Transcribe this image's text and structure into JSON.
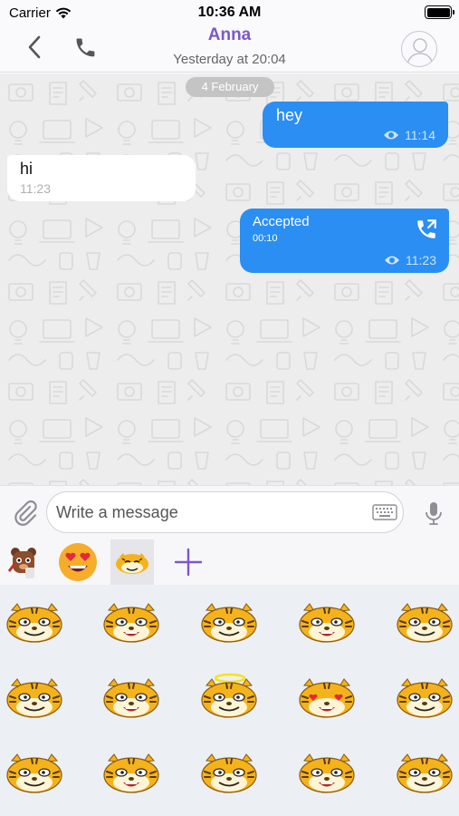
{
  "status_bar": {
    "carrier": "Carrier",
    "time": "10:36 AM"
  },
  "header": {
    "contact_name": "Anna",
    "last_seen": "Yesterday at 20:04"
  },
  "chat": {
    "date_separator": "4 February",
    "messages": [
      {
        "direction": "outgoing",
        "text": "hey",
        "time": "11:14",
        "status": "seen-eye-icon"
      },
      {
        "direction": "incoming",
        "text": "hi",
        "time": "11:23"
      },
      {
        "direction": "outgoing",
        "type": "call",
        "text": "Accepted",
        "duration": "00:10",
        "time": "11:23",
        "status": "seen-eye-icon"
      }
    ]
  },
  "composer": {
    "placeholder": "Write a message"
  },
  "sticker_tabs": [
    "coffee-bear-sticker-pack-icon",
    "heart-eyes-emoji-icon",
    "tiger-sticker-pack-icon",
    "add-pack-icon"
  ],
  "colors": {
    "accent": "#7d57c9",
    "outgoing_bubble": "#2b8ef2",
    "incoming_bubble": "#ffffff",
    "chat_background": "#ededed"
  },
  "stickers": [
    "tiger-sticker-smug",
    "tiger-sticker-tongue",
    "tiger-sticker-grin",
    "tiger-sticker-camera",
    "tiger-sticker-shocked",
    "tiger-sticker-angry",
    "tiger-sticker-sly",
    "tiger-sticker-angel",
    "tiger-sticker-love",
    "tiger-sticker-worried",
    "tiger-sticker-pondering",
    "tiger-sticker-unimpressed",
    "tiger-sticker-facepalm",
    "tiger-sticker-laughing",
    "tiger-sticker-sad"
  ]
}
